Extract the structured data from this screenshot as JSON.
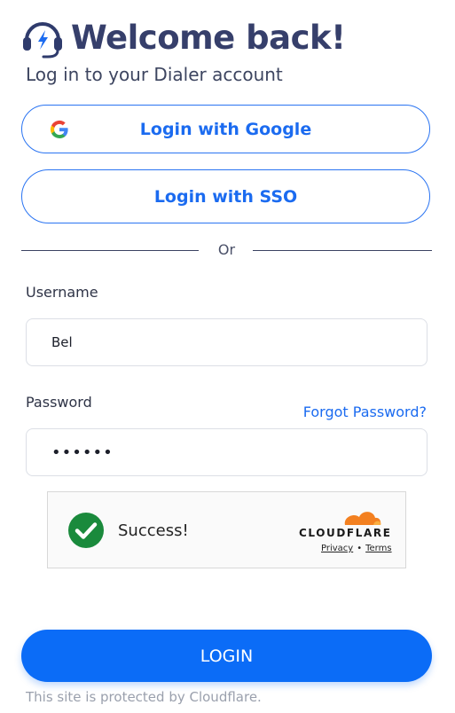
{
  "header": {
    "title": "Welcome back!",
    "subtitle": "Log in to your Dialer account",
    "logo_icon": "headset-lightning-icon"
  },
  "oauth": {
    "google_label": "Login with Google",
    "sso_label": "Login with SSO"
  },
  "divider_text": "Or",
  "form": {
    "username_label": "Username",
    "username_value": "Bel",
    "password_label": "Password",
    "password_value": "••••••",
    "forgot_label": "Forgot Password?"
  },
  "captcha": {
    "status": "Success!",
    "provider": "CLOUDFLARE",
    "privacy_label": "Privacy",
    "terms_label": "Terms",
    "separator": "•"
  },
  "login_button": "LOGIN",
  "footer": "This site is protected by Cloudflare.",
  "colors": {
    "primary": "#0b6cf7",
    "title": "#363f6b",
    "success": "#1a8a3c",
    "cloudflare_orange": "#f38020"
  }
}
